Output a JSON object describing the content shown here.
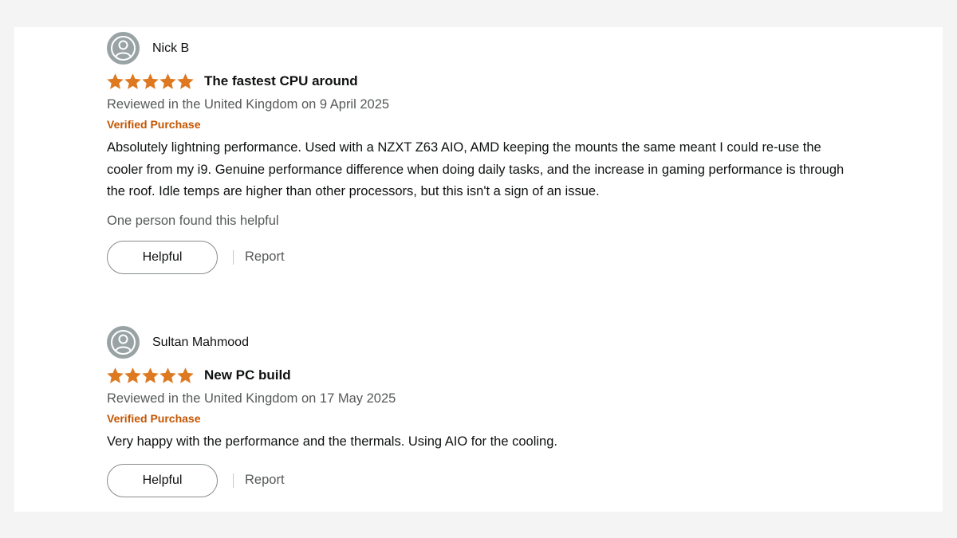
{
  "colors": {
    "star": "#de7921",
    "verified": "#c45500",
    "muted_text": "#565959",
    "text": "#0f1111"
  },
  "reviews": [
    {
      "author": "Nick B",
      "avatar_icon": "user-silhouette-icon",
      "rating": 5,
      "title": "The fastest CPU around",
      "date": "Reviewed in the United Kingdom on 9 April 2025",
      "verified": "Verified Purchase",
      "body": "Absolutely lightning performance. Used with a NZXT Z63 AIO, AMD keeping the mounts the same meant I could re-use the cooler from my i9. Genuine performance difference when doing daily tasks, and the increase in gaming performance is through the roof. Idle temps are higher than other processors, but this isn't a sign of an issue.",
      "helpful_count": "One person found this helpful",
      "helpful_label": "Helpful",
      "report_label": "Report"
    },
    {
      "author": "Sultan Mahmood",
      "avatar_icon": "user-silhouette-icon",
      "rating": 5,
      "title": "New PC build",
      "date": "Reviewed in the United Kingdom on 17 May 2025",
      "verified": "Verified Purchase",
      "body": "Very happy with the performance and the thermals. Using AIO for the cooling.",
      "helpful_label": "Helpful",
      "report_label": "Report"
    }
  ]
}
